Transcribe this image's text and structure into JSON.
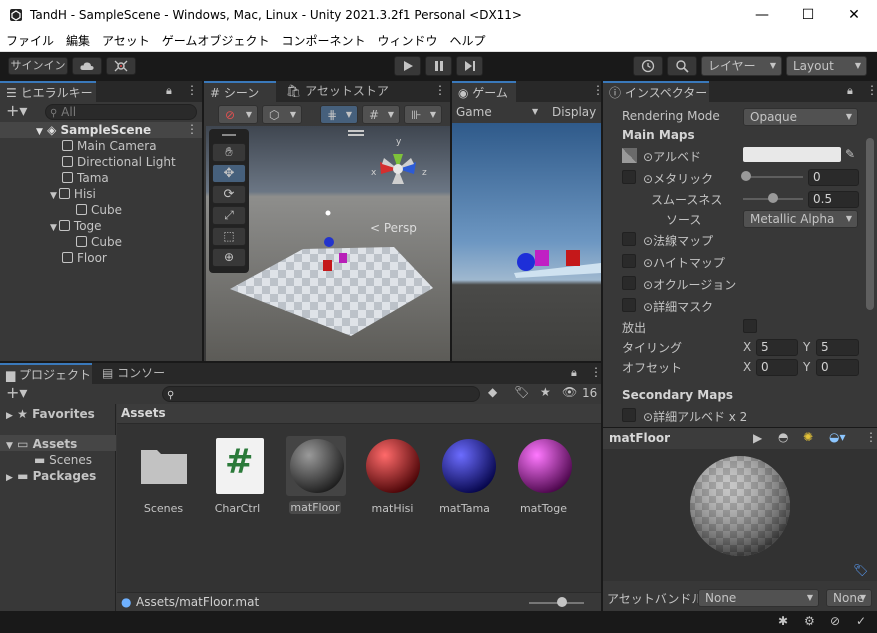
{
  "window": {
    "title": "TandH - SampleScene - Windows, Mac, Linux - Unity 2021.3.2f1 Personal <DX11>",
    "minimize": "—",
    "maximize": "☐",
    "close": "✕"
  },
  "menu": [
    "ファイル",
    "編集",
    "アセット",
    "ゲームオブジェクト",
    "コンポーネント",
    "ウィンドウ",
    "ヘルプ"
  ],
  "toolbar": {
    "signin": "サインイン",
    "layers": "レイヤー",
    "layout": "Layout"
  },
  "hierarchy": {
    "tab": "ヒエラルキー",
    "search_placeholder": "All",
    "items": [
      {
        "label": "SampleScene"
      },
      {
        "label": "Main Camera"
      },
      {
        "label": "Directional Light"
      },
      {
        "label": "Tama"
      },
      {
        "label": "Hisi"
      },
      {
        "label": "Cube"
      },
      {
        "label": "Toge"
      },
      {
        "label": "Cube"
      },
      {
        "label": "Floor"
      }
    ]
  },
  "scene": {
    "tab": "シーン",
    "store_tab": "アセットストア",
    "persp": "< Persp",
    "axis_y": "y",
    "axis_z": "z",
    "axis_x": "x"
  },
  "game": {
    "tab": "ゲーム",
    "display_mode": "Game",
    "display": "Display"
  },
  "inspector": {
    "tab": "インスペクター",
    "rendering_mode_label": "Rendering Mode",
    "rendering_mode": "Opaque",
    "main_maps": "Main Maps",
    "albedo": "アルベド",
    "metallic": "メタリック",
    "metallic_value": "0",
    "smoothness": "スムースネス",
    "smoothness_value": "0.5",
    "source": "ソース",
    "source_value": "Metallic Alpha",
    "normal_map": "法線マップ",
    "height_map": "ハイトマップ",
    "occlusion": "オクルージョン",
    "detail_mask": "詳細マスク",
    "emission": "放出",
    "tiling": "タイリング",
    "offset": "オフセット",
    "tiling_x": "5",
    "tiling_y": "5",
    "offset_x": "0",
    "offset_y": "0",
    "x": "X",
    "y": "Y",
    "secondary_maps": "Secondary Maps",
    "detail_albedo": "詳細アルベド x 2",
    "preview_title": "matFloor",
    "asset_bundle_label": "アセットバンドル",
    "asset_bundle": "None",
    "asset_bundle_variant": "None"
  },
  "project": {
    "tab": "プロジェクト",
    "console_tab": "コンソール",
    "hidden_count": "16",
    "favorites": "Favorites",
    "assets": "Assets",
    "scenes": "Scenes",
    "packages": "Packages",
    "breadcrumb": "Assets",
    "items": [
      {
        "label": "Scenes"
      },
      {
        "label": "CharCtrl"
      },
      {
        "label": "matFloor"
      },
      {
        "label": "matHisi"
      },
      {
        "label": "matTama"
      },
      {
        "label": "matToge"
      }
    ],
    "path": "Assets/matFloor.mat",
    "script_glyph": "#"
  },
  "colors": {
    "accent": "#3a79bb",
    "selection": "#2c5d87",
    "panel": "#383838",
    "dark": "#282828",
    "matHisi": "#c0181b",
    "matTama": "#1d1fd0",
    "matToge": "#c420c4"
  }
}
